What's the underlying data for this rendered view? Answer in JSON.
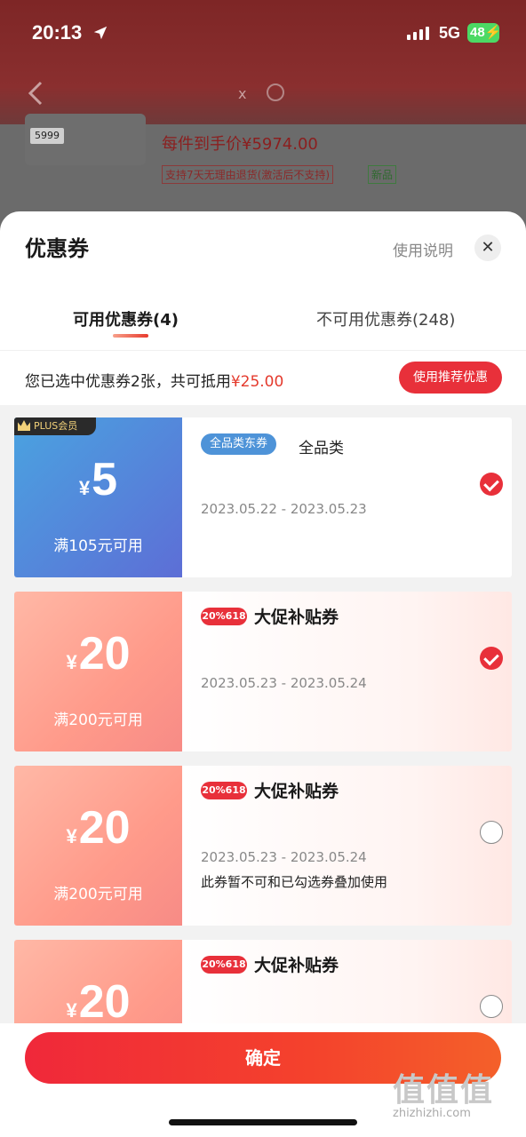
{
  "status": {
    "time": "20:13",
    "network": "5G",
    "battery": "48"
  },
  "behind": {
    "product_tag": "5999",
    "price_text": "每件到手价¥5974.00",
    "badge_return": "支持7天无理由退货(激活后不支持)",
    "badge_new": "新品",
    "x": "x"
  },
  "sheet": {
    "title": "优惠券",
    "help": "使用说明",
    "close": "✕",
    "tabs": [
      {
        "label": "可用优惠券(4)"
      },
      {
        "label": "不可用优惠券(248)"
      }
    ],
    "selection_prefix": "您已选中优惠券2张，共可抵用",
    "selection_amount": "¥25.00",
    "recommend_button": "使用推荐优惠"
  },
  "coupons": [
    {
      "tag": "PLUS会员",
      "currency": "¥",
      "amount": "5",
      "condition": "满105元可用",
      "badge": "全品类东券",
      "category": "全品类",
      "dates": "2023.05.22 - 2023.05.23",
      "checked": true
    },
    {
      "badge": "20%618",
      "currency": "¥",
      "amount": "20",
      "condition": "满200元可用",
      "category": "大促补贴券",
      "dates": "2023.05.23 - 2023.05.24",
      "checked": true
    },
    {
      "badge": "20%618",
      "currency": "¥",
      "amount": "20",
      "condition": "满200元可用",
      "category": "大促补贴券",
      "dates": "2023.05.23 - 2023.05.24",
      "note": "此券暂不可和已勾选券叠加使用",
      "checked": false
    },
    {
      "badge": "20%618",
      "currency": "¥",
      "amount": "20",
      "category": "大促补贴券",
      "checked": false
    }
  ],
  "footer": {
    "confirm": "确定"
  },
  "watermark": {
    "big": "值值值",
    "small": "zhizhizhi.com"
  }
}
